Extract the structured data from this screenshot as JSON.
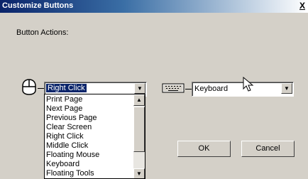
{
  "window": {
    "title": "Customize Buttons",
    "close_label": "X"
  },
  "section": {
    "label": "Button Actions:"
  },
  "mouse_combo": {
    "selected": "Right Click"
  },
  "mouse_list": {
    "items": [
      "Print Page",
      "Next Page",
      "Previous Page",
      "Clear Screen",
      "Right Click",
      "Middle Click",
      "Floating Mouse",
      "Keyboard",
      "Floating Tools"
    ]
  },
  "keyboard_combo": {
    "selected": "Keyboard"
  },
  "buttons": {
    "ok": "OK",
    "cancel": "Cancel"
  },
  "icons": {
    "mouse": "mouse-icon",
    "keyboard": "keyboard-icon",
    "cursor": "cursor-icon"
  }
}
